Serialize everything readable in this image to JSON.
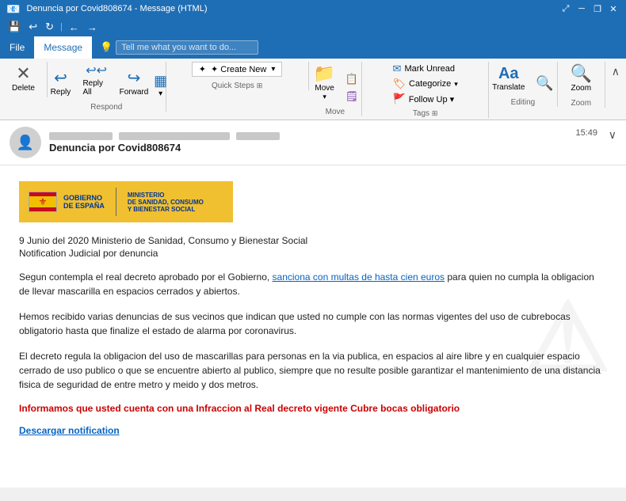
{
  "titlebar": {
    "title": "Denuncia por Covid808674 - Message (HTML)",
    "save_icon": "💾",
    "undo_icon": "↩",
    "redo_icon": "↻",
    "prev_icon": "←",
    "next_icon": "→",
    "expand_icon": "⤢",
    "minimize_icon": "─",
    "restore_icon": "❐",
    "close_icon": "✕"
  },
  "quickaccess": {
    "back_icon": "←",
    "forward_icon": "→",
    "up_icon": "↑"
  },
  "menubar": {
    "file_label": "File",
    "message_label": "Message",
    "tell_me_placeholder": "Tell me what you want to do...",
    "search_icon": "🔍"
  },
  "ribbon": {
    "groups": {
      "delete": {
        "label": "Delete",
        "btn_icon": "✕",
        "btn_label": "Delete"
      },
      "respond": {
        "label": "Respond",
        "reply_icon": "↩",
        "reply_label": "Reply",
        "reply_all_label": "Reply All",
        "forward_icon": "→",
        "forward_label": "Forward",
        "more_icon": "▾"
      },
      "quicksteps": {
        "label": "Quick Steps",
        "create_new_label": "✦ Create New",
        "arrow_icon": "▾",
        "expand_icon": "⊞"
      },
      "move": {
        "label": "Move",
        "move_icon": "📁",
        "move_label": "Move",
        "arrow_icon": "▾",
        "more_icon": "⊞"
      },
      "tags": {
        "label": "Tags",
        "mark_unread_label": "Mark Unread",
        "categorize_label": "Categorize",
        "followup_label": "Follow Up ▾",
        "unread_icon": "✉",
        "cat_icon": "🏷",
        "flag_icon": "🚩",
        "expand_icon": "⊞"
      },
      "editing": {
        "label": "Editing",
        "translate_icon": "Aa",
        "translate_label": "Translate",
        "search_icon": "🔍",
        "expand_icon": "⊞"
      },
      "zoom": {
        "label": "Zoom",
        "zoom_icon": "🔍",
        "zoom_label": "Zoom"
      }
    }
  },
  "email": {
    "avatar_icon": "👤",
    "from_blur1": "",
    "from_blur2": "",
    "from_blur3": "",
    "subject": "Denuncia por Covid808674",
    "time": "15:49",
    "expand_icon": "∨"
  },
  "govlogo": {
    "country": "GOBIERNO",
    "country2": "DE ESPAÑA",
    "divider": "",
    "ministry_line1": "MINISTERIO",
    "ministry_line2": "DE SANIDAD, CONSUMO",
    "ministry_line3": "Y BIENESTAR SOCIAL"
  },
  "body": {
    "date_line": "9 Junio del 2020 Ministerio de Sanidad, Consumo y Bienestar Social",
    "notification_line": "Notification Judicial por denuncia",
    "para1_before": "Segun contempla el real decreto aprobado por el Gobierno, ",
    "para1_link": "sanciona con multas de hasta cien euros",
    "para1_after": " para quien no cumpla la obligacion de llevar mascarilla en espacios cerrados y abiertos.",
    "para2": "Hemos recibido varias denuncias de sus vecinos que indican que usted no cumple con las normas vigentes del uso de cubrebocas obligatorio hasta que finalize el estado de alarma por coronavirus.",
    "para3": "El decreto regula la obligacion del uso de mascarillas para personas en la via publica, en espacios al aire libre y en cualquier espacio cerrado de uso publico o que se encuentre abierto al publico, siempre que no resulte posible garantizar el mantenimiento de una distancia fisica de seguridad de entre metro y meido y dos metros.",
    "warning": "Informamos que usted cuenta con una Infraccion al Real decreto vigente Cubre bocas obligatorio",
    "download_link": "Descargar notification",
    "watermark": "⚠"
  }
}
